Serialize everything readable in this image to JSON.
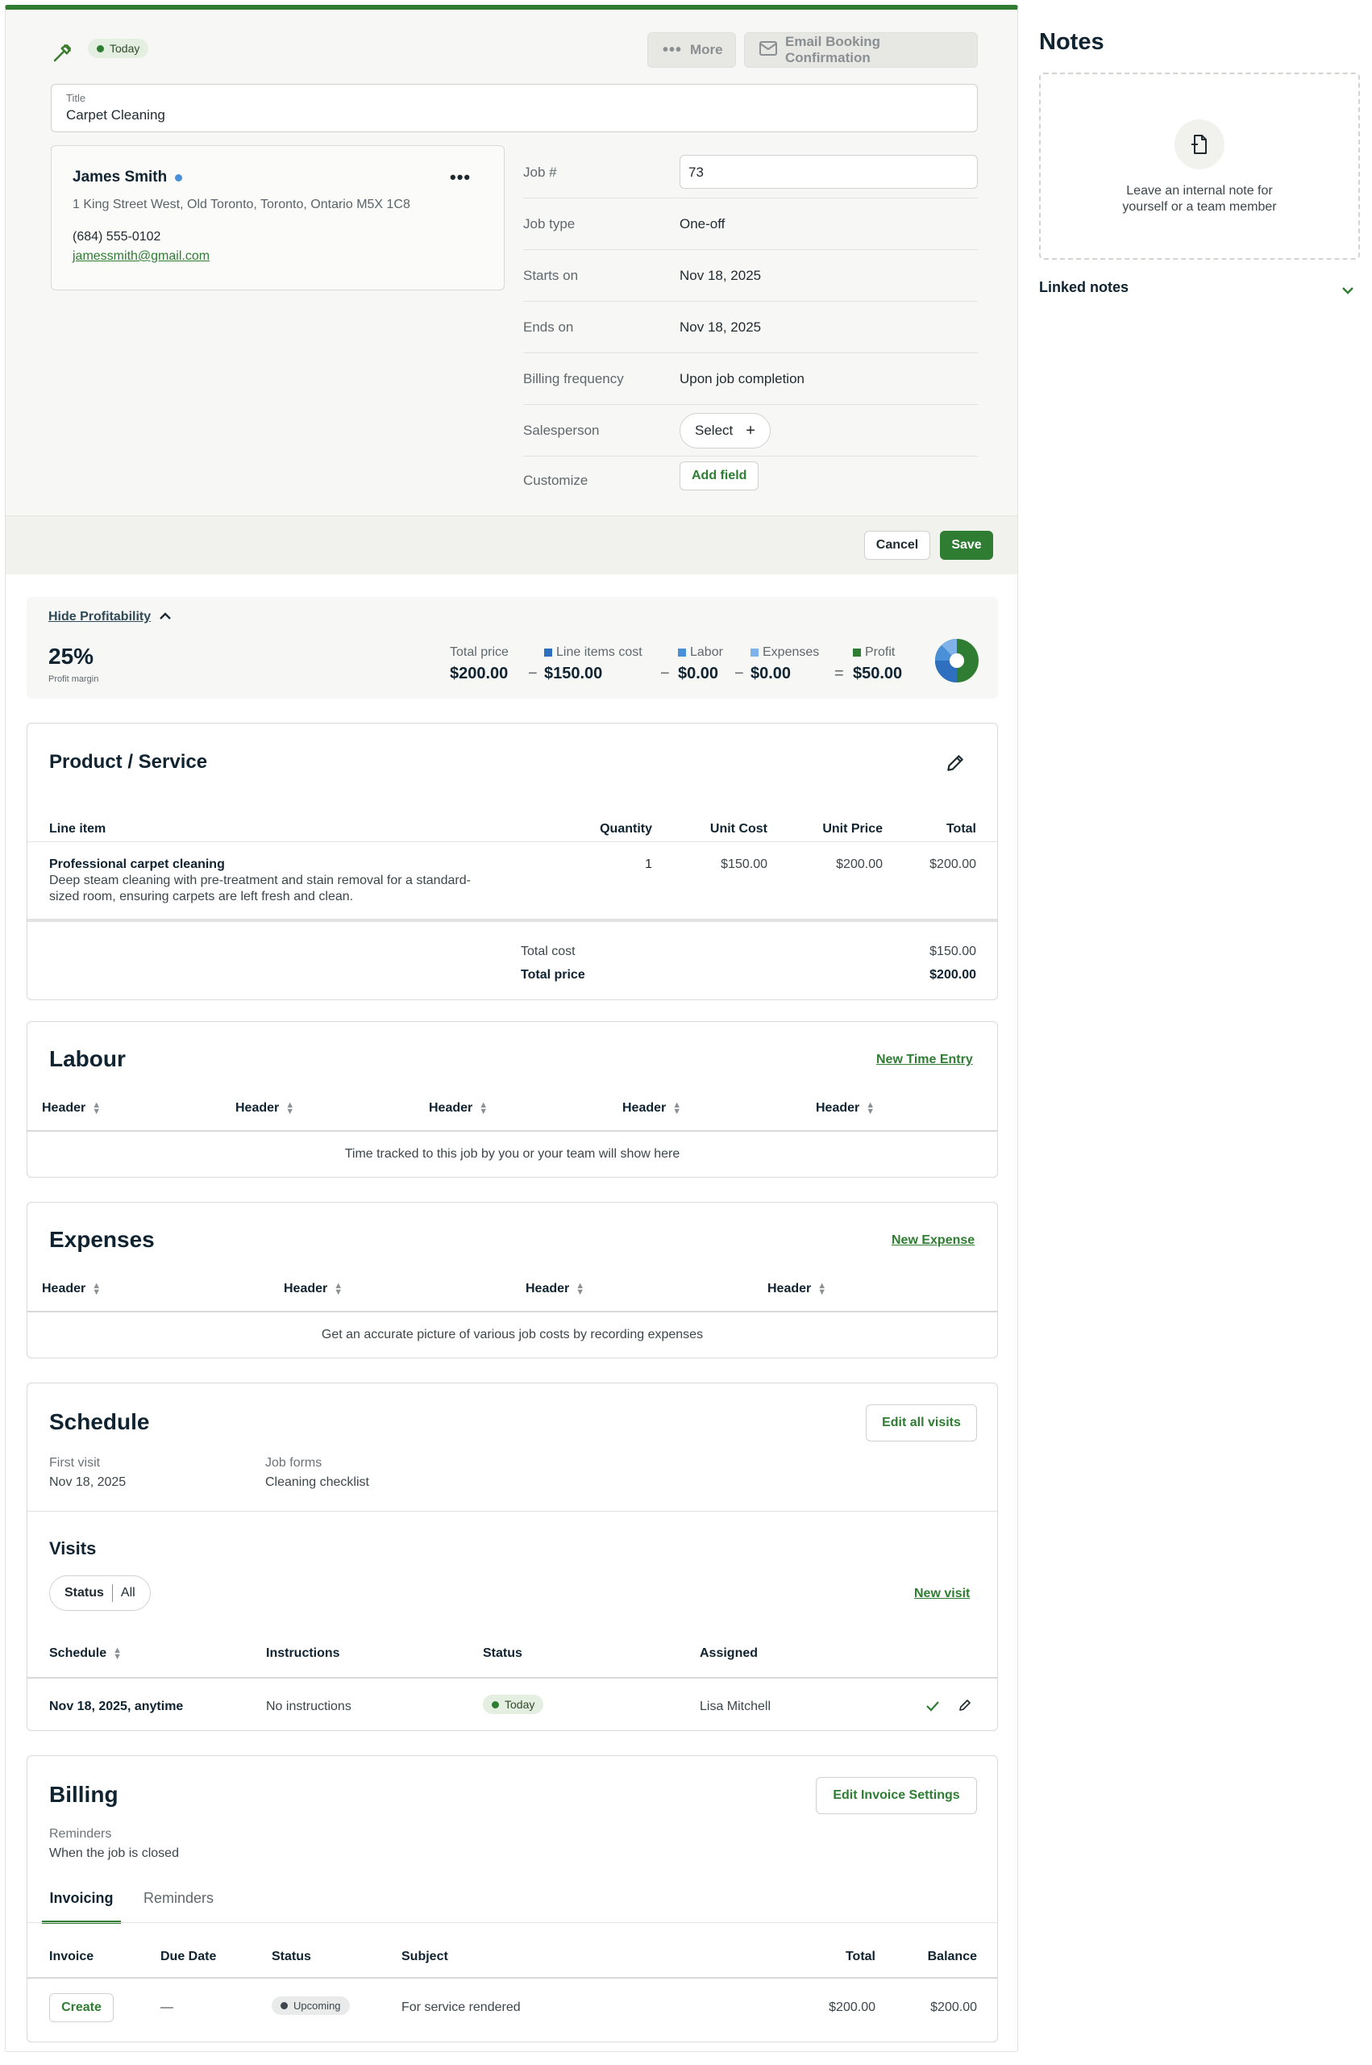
{
  "header": {
    "badge": "Today",
    "more_label": "More",
    "email_label": "Email Booking Confirmation"
  },
  "title_field": {
    "label": "Title",
    "value": "Carpet Cleaning"
  },
  "client": {
    "name": "James Smith",
    "address": "1 King Street West, Old Toronto, Toronto, Ontario M5X 1C8",
    "phone": "(684) 555-0102",
    "email": "jamessmith@gmail.com"
  },
  "details": {
    "job_num_label": "Job #",
    "job_num_value": "73",
    "job_type_label": "Job type",
    "job_type_value": "One-off",
    "starts_label": "Starts on",
    "starts_value": "Nov 18, 2025",
    "ends_label": "Ends on",
    "ends_value": "Nov 18, 2025",
    "billing_label": "Billing frequency",
    "billing_value": "Upon job completion",
    "sales_label": "Salesperson",
    "sales_value": "Select",
    "customize_label": "Customize",
    "customize_value": "Add field"
  },
  "actions": {
    "cancel": "Cancel",
    "save": "Save"
  },
  "profitability": {
    "toggle": "Hide Profitability",
    "margin": "25%",
    "margin_label": "Profit margin",
    "total_price_label": "Total price",
    "total_price": "$200.00",
    "line_items_label": "Line items cost",
    "line_items": "$150.00",
    "labor_label": "Labor",
    "labor": "$0.00",
    "expenses_label": "Expenses",
    "expenses": "$0.00",
    "profit_label": "Profit",
    "profit": "$50.00",
    "minus": "−",
    "equals": "=",
    "colors": {
      "line_items": "#2f6fbf",
      "labor": "#4a90d9",
      "expenses": "#7fb2e8",
      "profit": "#2e7d32"
    }
  },
  "product": {
    "title": "Product / Service",
    "headers": [
      "Line item",
      "Quantity",
      "Unit Cost",
      "Unit Price",
      "Total"
    ],
    "item_name": "Professional carpet cleaning",
    "item_desc_1": "Deep steam cleaning with pre-treatment and stain removal for a standard-",
    "item_desc_2": "sized room, ensuring carpets are left fresh and clean.",
    "qty": "1",
    "unit_cost": "$150.00",
    "unit_price": "$200.00",
    "total": "$200.00",
    "total_cost_label": "Total cost",
    "total_cost": "$150.00",
    "total_price_label": "Total price",
    "total_price": "$200.00"
  },
  "labour": {
    "title": "Labour",
    "link": "New Time Entry",
    "headers": [
      "Header",
      "Header",
      "Header",
      "Header",
      "Header"
    ],
    "empty": "Time tracked to this job by you or your team will show here"
  },
  "expenses": {
    "title": "Expenses",
    "link": "New Expense",
    "headers": [
      "Header",
      "Header",
      "Header",
      "Header"
    ],
    "empty": "Get an accurate picture of various job costs by recording expenses"
  },
  "schedule": {
    "title": "Schedule",
    "edit": "Edit all visits",
    "first_visit_label": "First visit",
    "first_visit": "Nov 18, 2025",
    "job_forms_label": "Job forms",
    "job_forms": "Cleaning checklist",
    "visits_title": "Visits",
    "filter_label": "Status",
    "filter_value": "All",
    "new_visit": "New visit",
    "headers": [
      "Schedule",
      "Instructions",
      "Status",
      "Assigned"
    ],
    "row": {
      "schedule": "Nov 18, 2025, anytime",
      "instructions": "No instructions",
      "status": "Today",
      "assigned": "Lisa Mitchell"
    }
  },
  "billing": {
    "title": "Billing",
    "edit": "Edit Invoice Settings",
    "reminders_label": "Reminders",
    "reminders_value": "When the job is closed",
    "tabs": [
      "Invoicing",
      "Reminders"
    ],
    "headers": [
      "Invoice",
      "Due Date",
      "Status",
      "Subject",
      "Total",
      "Balance"
    ],
    "row": {
      "invoice": "Create",
      "due": "—",
      "status": "Upcoming",
      "subject": "For service rendered",
      "total": "$200.00",
      "balance": "$200.00"
    }
  },
  "notes": {
    "title": "Notes",
    "empty_1": "Leave an internal note for",
    "empty_2": "yourself or a team member",
    "linked": "Linked notes"
  }
}
